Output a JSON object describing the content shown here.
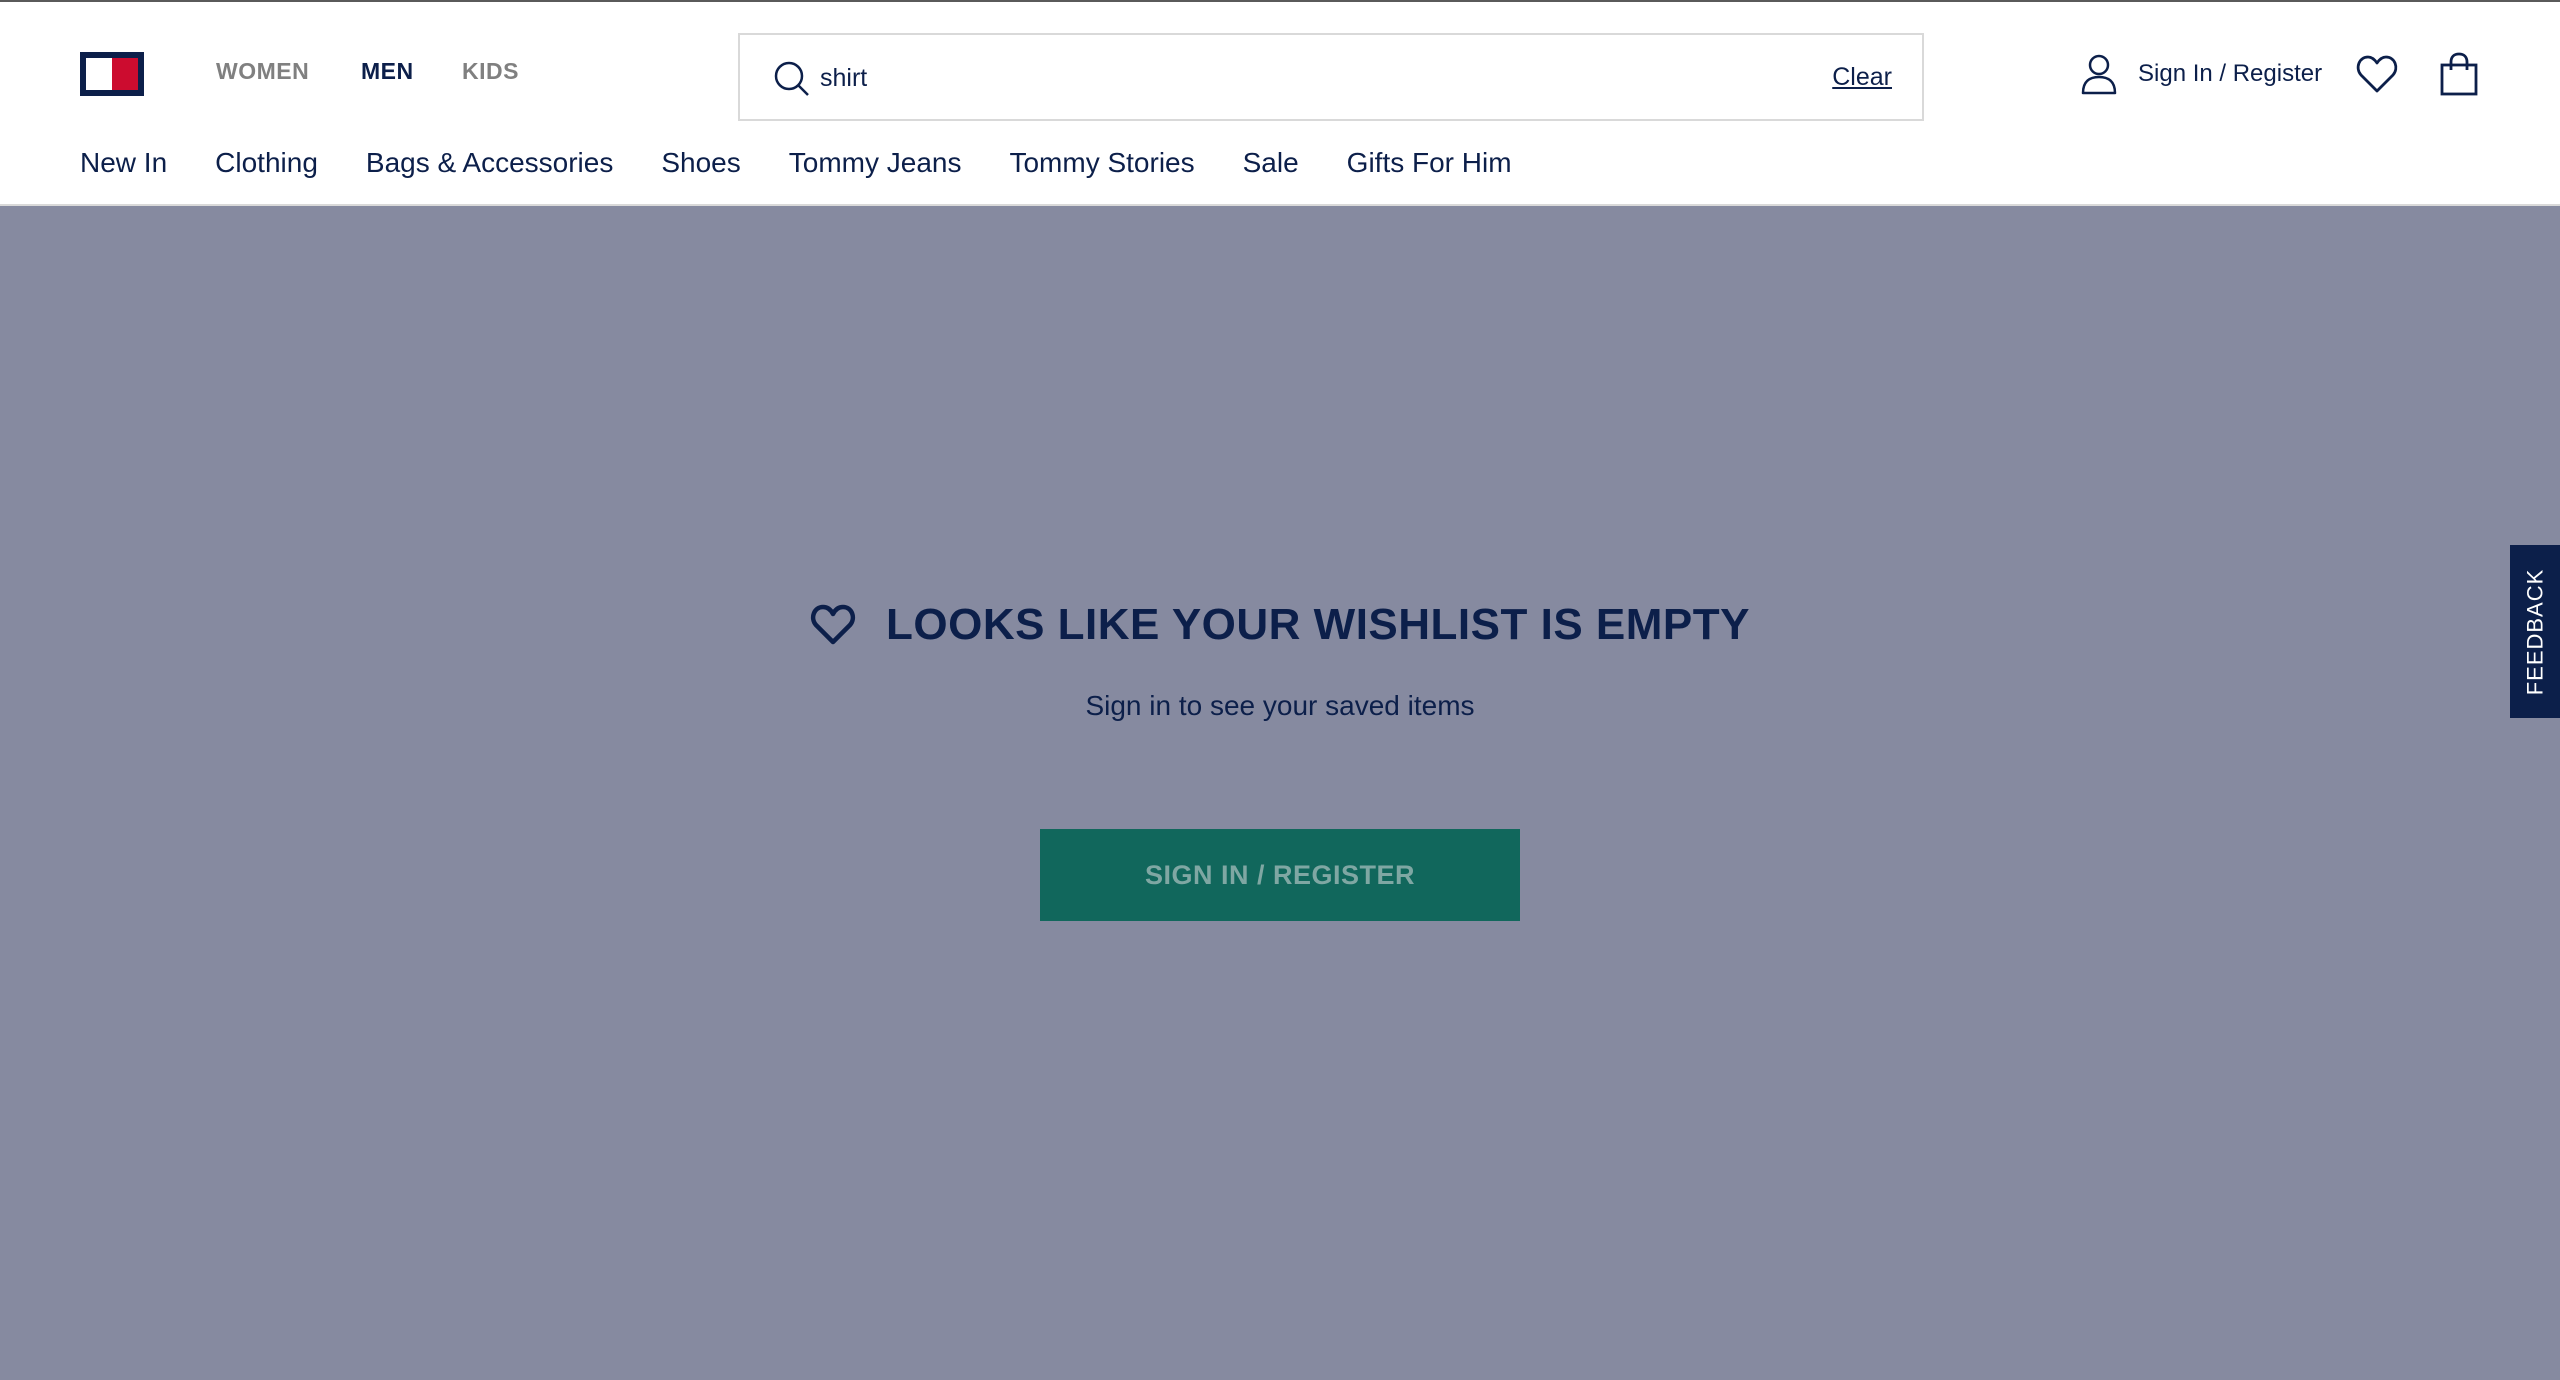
{
  "header": {
    "gender_tabs": [
      {
        "label": "WOMEN",
        "active": false
      },
      {
        "label": "MEN",
        "active": true
      },
      {
        "label": "KIDS",
        "active": false
      }
    ],
    "search": {
      "value": "shirt",
      "clear_label": "Clear"
    },
    "account_label": "Sign In / Register",
    "icons": [
      "search-icon",
      "user-icon",
      "heart-icon",
      "shopping-bag-icon"
    ]
  },
  "nav": {
    "items": [
      "New In",
      "Clothing",
      "Bags & Accessories",
      "Shoes",
      "Tommy Jeans",
      "Tommy Stories",
      "Sale",
      "Gifts For Him"
    ]
  },
  "wishlist": {
    "title": "LOOKS LIKE YOUR WISHLIST IS EMPTY",
    "subtitle": "Sign in to see your saved items",
    "button_label": "SIGN IN / REGISTER"
  },
  "feedback_label": "FEEDBACK",
  "colors": {
    "navy": "#0c1f4a",
    "red": "#cc0c2f",
    "overlay": "#868aa0",
    "cta": "#11675c"
  }
}
